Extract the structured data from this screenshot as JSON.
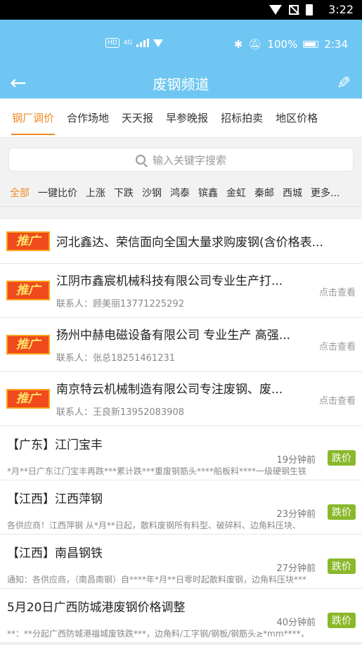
{
  "device_status": {
    "time": "3:22"
  },
  "inner_status": {
    "battery": "100%",
    "time": "2:34",
    "hd": "HD",
    "net": "4G"
  },
  "header": {
    "title": "废钢频道",
    "back_icon": "←",
    "edit_icon": "✎"
  },
  "tabs": [
    "钢厂调价",
    "合作场地",
    "天天报",
    "早参晚报",
    "招标拍卖",
    "地区价格"
  ],
  "search": {
    "placeholder": "输入关键字搜索"
  },
  "filters": [
    "全部",
    "一键比价",
    "上涨",
    "下跌",
    "沙钢",
    "鸿泰",
    "镔鑫",
    "金虹",
    "秦邮",
    "西城",
    "更多..."
  ],
  "ads": {
    "badge": "推广",
    "view_label": "点击查看",
    "items": [
      {
        "title": "河北鑫达、荣信面向全国大量求购废钢(含价格表..."
      },
      {
        "title": "江阴市鑫宸机械科技有限公司专业生产打...",
        "contact": "联系人：顾美丽13771225292"
      },
      {
        "title": "扬州中赫电磁设备有限公司 专业生产 高强...",
        "contact": "联系人：张总18251461231"
      },
      {
        "title": "南京特云机械制造有限公司专注废钢、废...",
        "contact": "联系人：王良新13952083908"
      }
    ]
  },
  "news": [
    {
      "title": "【广东】江门宝丰",
      "time": "19分钟前",
      "tag": "跌价",
      "summary": "*月**日广东江门宝丰再跌***累计跌***重废钢筋头****船板料****一级硬钢生铁"
    },
    {
      "title": "【江西】江西萍钢",
      "time": "23分钟前",
      "tag": "跌价",
      "summary": "各供应商！江西萍钢 从*月**日起，散料废钢所有料型、破碎料、边角料压块、"
    },
    {
      "title": "【江西】南昌钢铁",
      "time": "27分钟前",
      "tag": "跌价",
      "summary": "通知：各供应商，（南昌南钢）自****年*月**日零时起散料废钢，边角料压块***"
    },
    {
      "title": "5月20日广西防城港废钢价格调整",
      "time": "40分钟前",
      "tag": "跌价",
      "summary": "**：**分起广西防城港福城废铁跌***，边角料/工字钢/钢板/钢筋头≥*mm****，"
    }
  ],
  "colors": {
    "accent": "#f08a24",
    "header_bg": "#6fc6f2",
    "tag_green": "#8ab82a",
    "badge_red": "#f04b1c"
  }
}
